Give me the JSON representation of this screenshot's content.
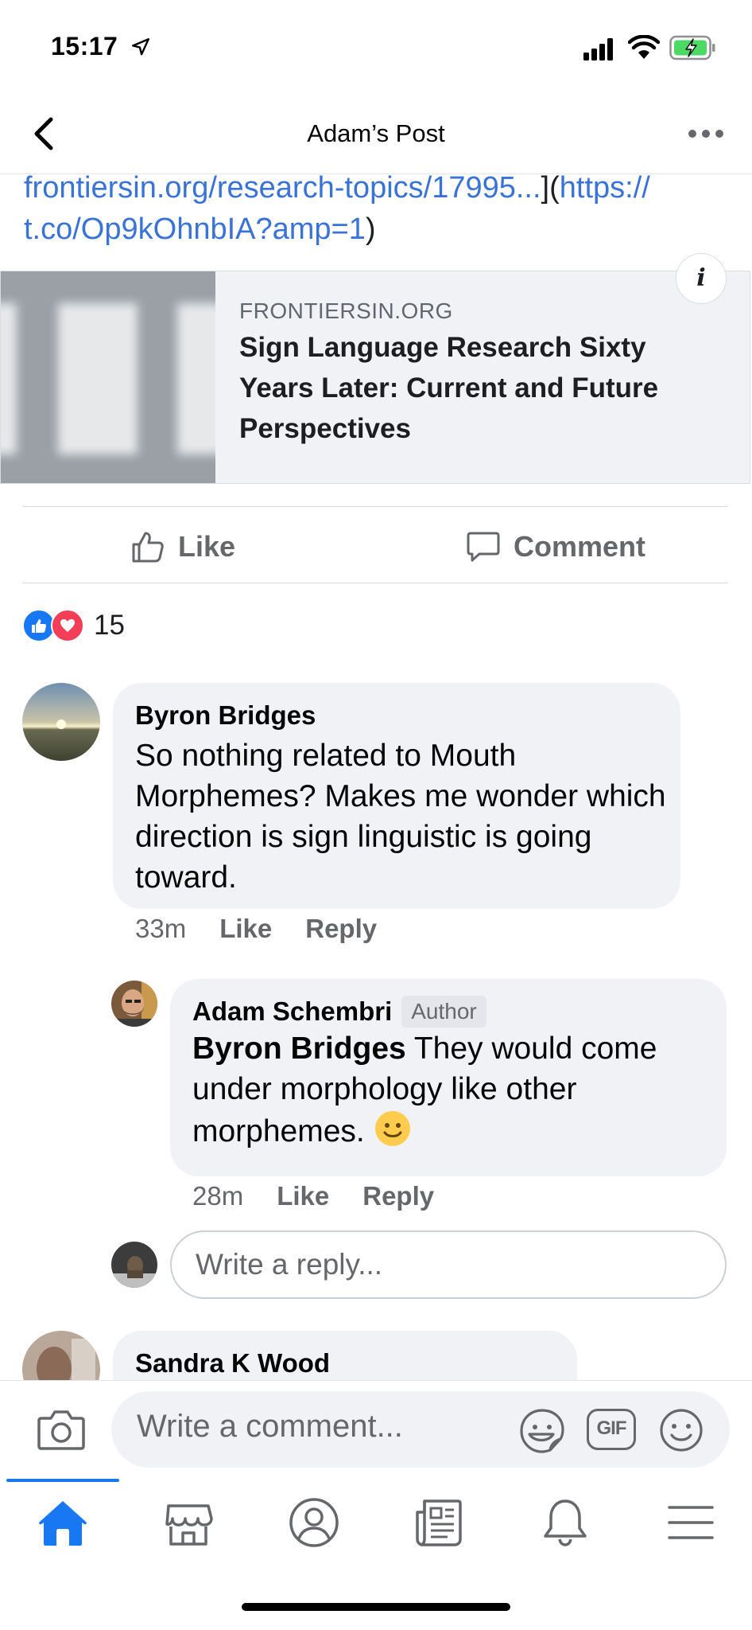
{
  "status_bar": {
    "time": "15:17"
  },
  "header": {
    "title": "Adam’s Post"
  },
  "post": {
    "link_part1": "frontiersin.org/research-topics/17995...",
    "bracket_close": "](",
    "link_part2": "https://",
    "link_part3": "t.co/Op9kOhnbIA?amp=1",
    "paren_close": ")"
  },
  "link_preview": {
    "domain": "FRONTIERSIN.ORG",
    "title": "Sign Language Research Sixty Years Later: Current and Future Perspectives"
  },
  "actions": {
    "like_label": "Like",
    "comment_label": "Comment"
  },
  "reactions": {
    "count": "15"
  },
  "comments": [
    {
      "author": "Byron Bridges",
      "text": "So nothing related to Mouth Morphemes?  Makes me wonder which direction is sign linguistic is going toward.",
      "time": "33m",
      "like_label": "Like",
      "reply_label": "Reply"
    },
    {
      "author": "Adam Schembri",
      "badge": "Author",
      "mention": "Byron Bridges",
      "text": " They would come under morphology like other morphemes.",
      "emoji": "🙂",
      "time": "28m",
      "like_label": "Like",
      "reply_label": "Reply"
    },
    {
      "author": "Sandra K Wood"
    }
  ],
  "reply_box": {
    "placeholder": "Write a reply..."
  },
  "composer": {
    "placeholder": "Write a comment...",
    "gif_label": "GIF"
  },
  "colors": {
    "link": "#3a73d6",
    "accent": "#1877f2",
    "love": "#f33e58",
    "battery": "#4cd964"
  }
}
